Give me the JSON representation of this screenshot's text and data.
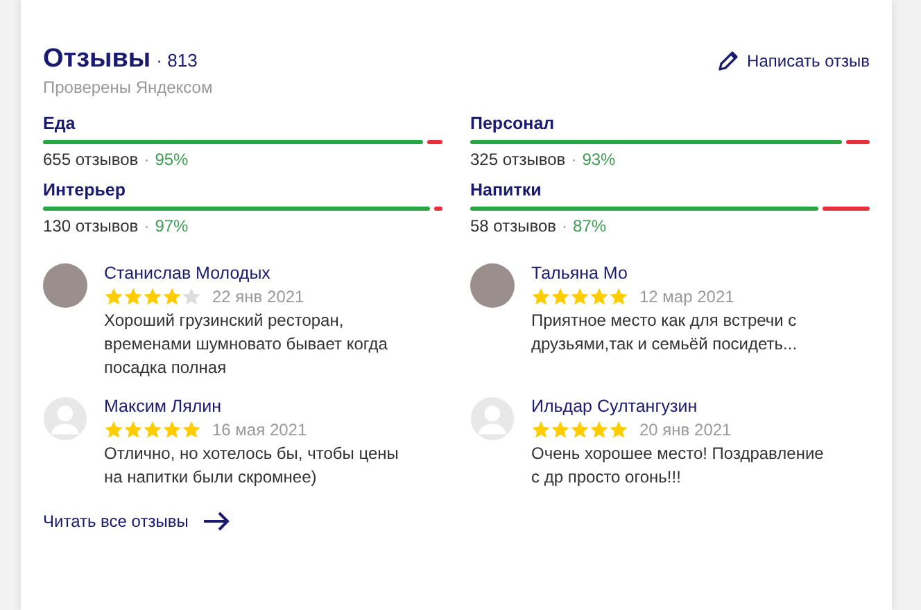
{
  "reviews_header": {
    "title": "Отзывы",
    "count": "· 813",
    "subtitle": "Проверены Яндексом",
    "write_button": "Написать отзыв"
  },
  "categories": [
    {
      "name": "Еда",
      "reviews": "655 отзывов",
      "separator": "·",
      "percent": "95%",
      "level": 0.95
    },
    {
      "name": "Персонал",
      "reviews": "325 отзывов",
      "separator": "·",
      "percent": "93%",
      "level": 0.93
    },
    {
      "name": "Интерьер",
      "reviews": "130 отзывов",
      "separator": "·",
      "percent": "97%",
      "level": 0.97
    },
    {
      "name": "Напитки",
      "reviews": "58 отзывов",
      "separator": "·",
      "percent": "87%",
      "level": 0.87
    }
  ],
  "reviews": [
    {
      "author": "Станислав Молодых",
      "kind": "photo",
      "stars": 4,
      "date": "22 янв 2021",
      "text": "Хороший грузинский ресторан, временами шумновато бывает когда посадка полная"
    },
    {
      "author": "Тальяна Мо",
      "kind": "photo",
      "stars": 5,
      "date": "12 мар 2021",
      "text": "Приятное место как для встречи с друзьями,так и семьёй посидеть..."
    },
    {
      "author": "Максим Лялин",
      "kind": "default",
      "stars": 5,
      "date": "16 мая 2021",
      "text": "Отлично, но хотелось бы, чтобы цены на напитки были скромнее)"
    },
    {
      "author": "Ильдар Султангузин",
      "kind": "default",
      "stars": 5,
      "date": "20 янв 2021",
      "text": "Очень хорошее место! Поздравление с др просто огонь!!!"
    }
  ],
  "read_all": "Читать все отзывы"
}
